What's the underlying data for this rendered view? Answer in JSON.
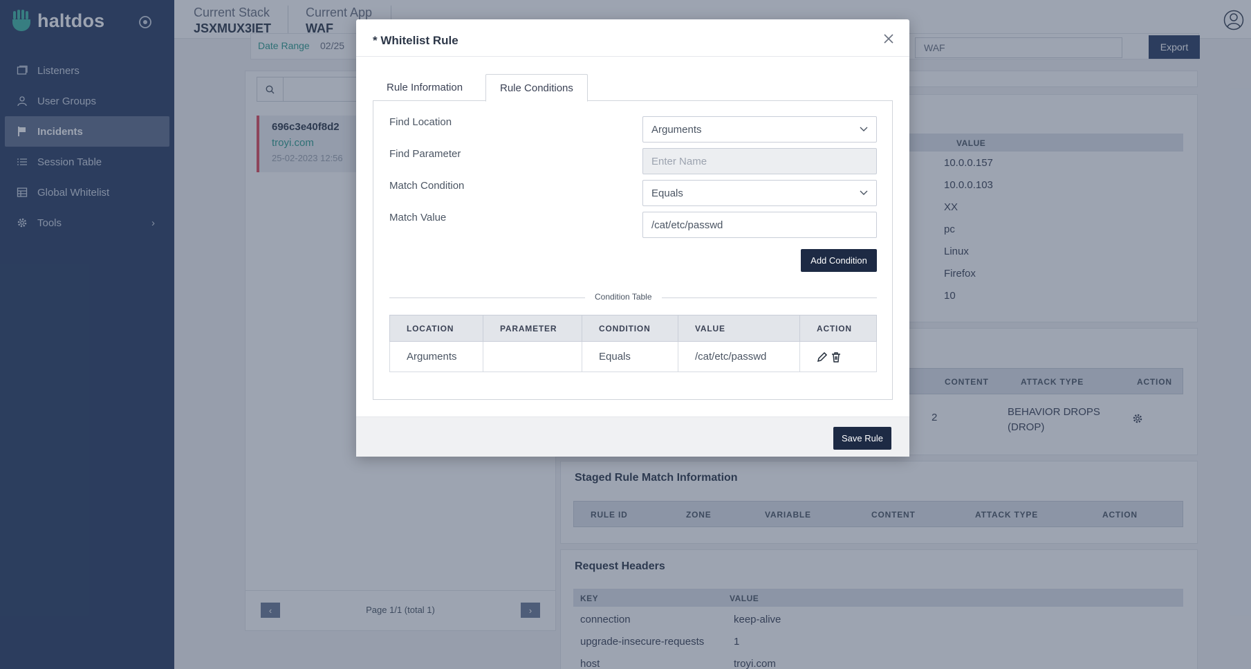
{
  "sidebar": {
    "brand": "haltdos",
    "items": [
      {
        "label": "Listeners",
        "icon": "window-icon"
      },
      {
        "label": "User Groups",
        "icon": "users-icon"
      },
      {
        "label": "Incidents",
        "icon": "flag-icon"
      },
      {
        "label": "Session Table",
        "icon": "list-icon"
      },
      {
        "label": "Global Whitelist",
        "icon": "table-icon"
      },
      {
        "label": "Tools",
        "icon": "gear-icon"
      }
    ]
  },
  "header": {
    "stack_label": "Current Stack",
    "stack_value": "JSXMUX3IET",
    "app_label": "Current App",
    "app_value": "WAF"
  },
  "background": {
    "date_label": "Date Range",
    "date_value": "02/25",
    "waf_select": "WAF",
    "export_label": "Export",
    "incident": {
      "id": "696c3e40f8d2",
      "host": "troyi.com",
      "time": "25-02-2023 12:56"
    },
    "pager_text": "Page 1/1 (total 1)",
    "info_value_head": "VALUE",
    "info_values": [
      "10.0.0.157",
      "10.0.0.103",
      "XX",
      "pc",
      "Linux",
      "Firefox",
      "10"
    ],
    "rule_table": {
      "headers": [
        "CONTENT",
        "ATTACK TYPE",
        "ACTION"
      ],
      "content": "2",
      "attack_type": "BEHAVIOR DROPS (DROP)"
    },
    "staged_title": "Staged Rule Match Information",
    "staged_headers": [
      "RULE ID",
      "ZONE",
      "VARIABLE",
      "CONTENT",
      "ATTACK TYPE",
      "ACTION"
    ],
    "headers_title": "Request Headers",
    "headers_head": [
      "KEY",
      "VALUE"
    ],
    "headers_rows": [
      {
        "key": "connection",
        "value": "keep-alive"
      },
      {
        "key": "upgrade-insecure-requests",
        "value": "1"
      },
      {
        "key": "host",
        "value": "troyi.com"
      }
    ]
  },
  "modal": {
    "title": "* Whitelist Rule",
    "tabs": [
      "Rule Information",
      "Rule Conditions"
    ],
    "form": {
      "find_location_label": "Find Location",
      "find_location_value": "Arguments",
      "find_parameter_label": "Find Parameter",
      "find_parameter_placeholder": "Enter Name",
      "match_condition_label": "Match Condition",
      "match_condition_value": "Equals",
      "match_value_label": "Match Value",
      "match_value_value": "/cat/etc/passwd"
    },
    "add_condition_label": "Add Condition",
    "condition_table_label": "Condition Table",
    "table": {
      "headers": [
        "LOCATION",
        "PARAMETER",
        "CONDITION",
        "VALUE",
        "ACTION"
      ],
      "rows": [
        {
          "location": "Arguments",
          "parameter": "",
          "condition": "Equals",
          "value": "/cat/etc/passwd"
        }
      ]
    },
    "save_label": "Save Rule"
  }
}
